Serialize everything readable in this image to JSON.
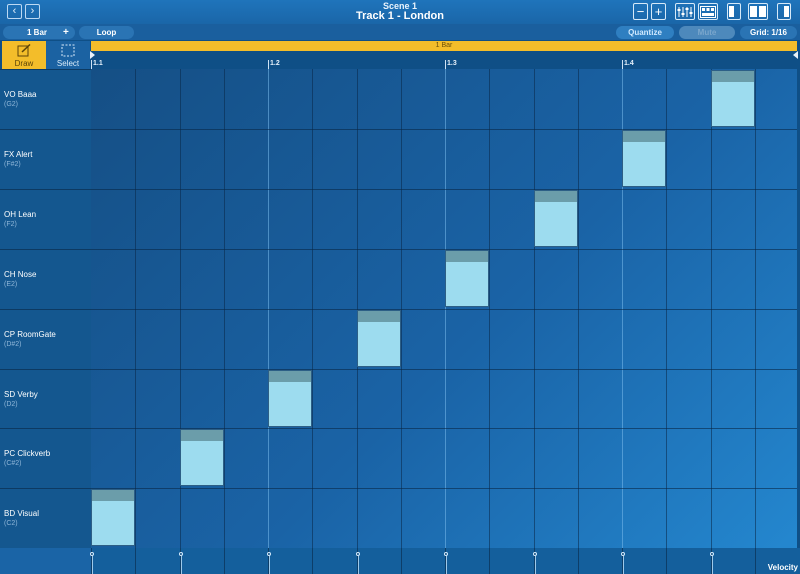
{
  "header": {
    "scene": "Scene 1",
    "track_title": "Track 1 - London",
    "back_icon": "chevron-left-icon",
    "forward_icon": "chevron-right-icon"
  },
  "toolbar": {
    "length_value": "1 Bar",
    "add_label": "+",
    "loop_label": "Loop",
    "quantize_label": "Quantize",
    "mute_label": "Mute",
    "grid_label": "Grid: 1/16"
  },
  "tools": {
    "draw_label": "Draw",
    "select_label": "Select",
    "active": "draw"
  },
  "timeline": {
    "loop_region_label": "1 Bar",
    "markers": [
      "1.1",
      "1.2",
      "1.3",
      "1.4"
    ]
  },
  "lanes": [
    {
      "name": "VO Baaa",
      "pitch": "(G2)"
    },
    {
      "name": "FX Alert",
      "pitch": "(F#2)"
    },
    {
      "name": "OH Lean",
      "pitch": "(F2)"
    },
    {
      "name": "CH Nose",
      "pitch": "(E2)"
    },
    {
      "name": "CP RoomGate",
      "pitch": "(D#2)"
    },
    {
      "name": "SD Verby",
      "pitch": "(D2)"
    },
    {
      "name": "PC Clickverb",
      "pitch": "(C#2)"
    },
    {
      "name": "BD Visual",
      "pitch": "(C2)"
    }
  ],
  "notes": [
    {
      "lane": 7,
      "step": 0
    },
    {
      "lane": 6,
      "step": 2
    },
    {
      "lane": 5,
      "step": 4
    },
    {
      "lane": 4,
      "step": 6
    },
    {
      "lane": 3,
      "step": 8
    },
    {
      "lane": 2,
      "step": 10
    },
    {
      "lane": 1,
      "step": 12
    },
    {
      "lane": 0,
      "step": 14
    }
  ],
  "velocity": {
    "label": "Velocity",
    "marker_steps": [
      0,
      2,
      4,
      6,
      8,
      10,
      12,
      14
    ]
  },
  "colors": {
    "loop_region": "#f3bd2a",
    "note_fill": "#9ddcef",
    "note_velocity_cap": "#6b9daa",
    "background": "#0f4f86"
  }
}
